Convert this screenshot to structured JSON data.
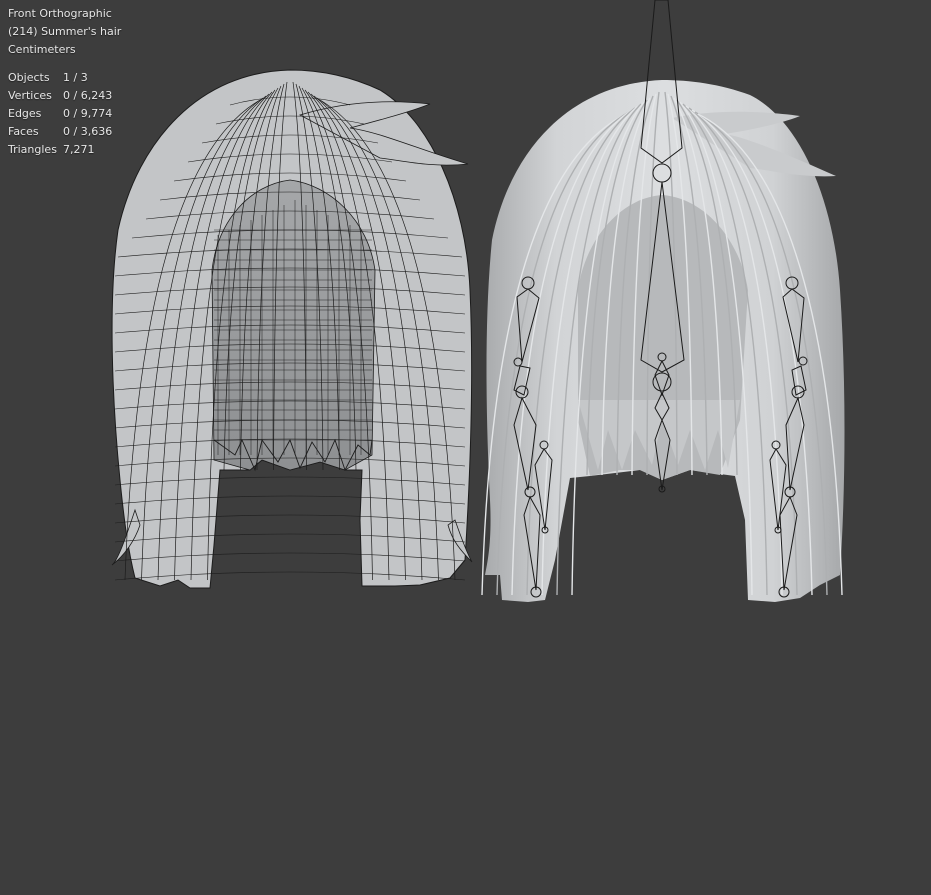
{
  "viewport": {
    "view_name": "Front Orthographic",
    "object_info": "(214) Summer's hair",
    "units": "Centimeters"
  },
  "stats": [
    {
      "label": "Objects",
      "value": "1 / 3"
    },
    {
      "label": "Vertices",
      "value": "0 / 6,243"
    },
    {
      "label": "Edges",
      "value": "0 / 9,774"
    },
    {
      "label": "Faces",
      "value": "0 / 3,636"
    },
    {
      "label": "Triangles",
      "value": "7,271"
    }
  ],
  "colors": {
    "background": "#3d3d3d",
    "mesh": "#c9cbcd",
    "wire": "#1e1e1e",
    "bone": "#1a1a1a"
  }
}
